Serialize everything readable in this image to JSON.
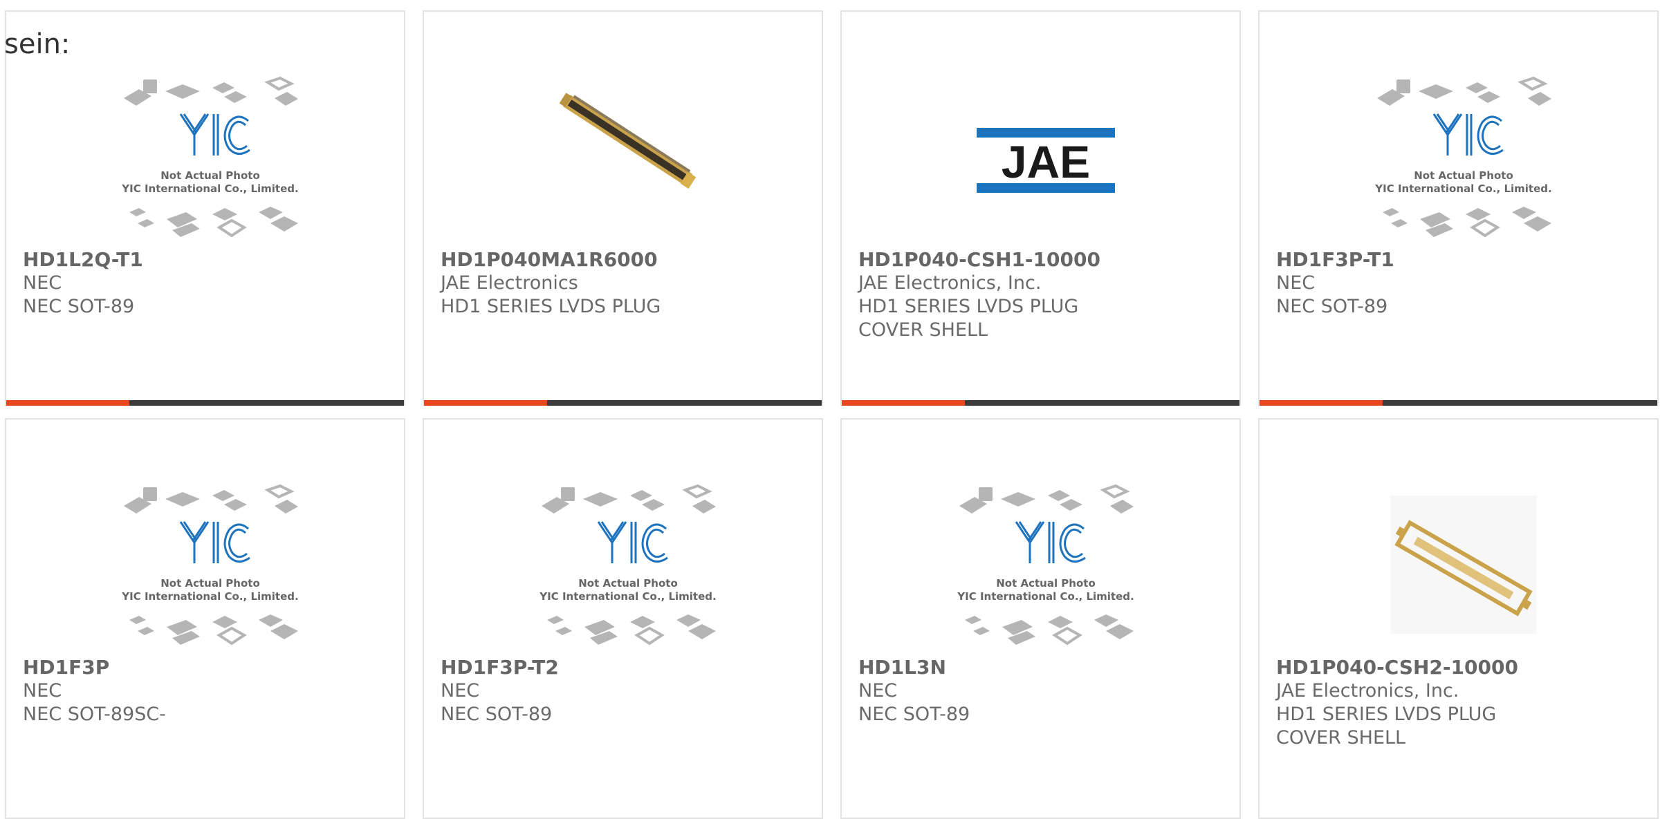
{
  "intro_text": "sein:",
  "theme": {
    "accent": "#e8461e",
    "bar": "#3a3a3a",
    "brand_blue": "#1e73be"
  },
  "placeholder_caption": [
    "Not Actual Photo",
    "YIC International Co., Limited."
  ],
  "placeholder_logo": "YIC",
  "jae_logo": "JAE",
  "progress_fraction": 0.31,
  "products": [
    {
      "part_number": "HD1L2Q-T1",
      "manufacturer": "NEC",
      "description": "NEC SOT-89",
      "image": "yic-placeholder"
    },
    {
      "part_number": "HD1P040MA1R6000",
      "manufacturer": "JAE Electronics",
      "description": "HD1 SERIES LVDS PLUG",
      "image": "connector-photo"
    },
    {
      "part_number": "HD1P040-CSH1-10000",
      "manufacturer": "JAE Electronics, Inc.",
      "description": "HD1 SERIES LVDS PLUG COVER SHELL",
      "image": "jae-logo"
    },
    {
      "part_number": "HD1F3P-T1",
      "manufacturer": "NEC",
      "description": "NEC SOT-89",
      "image": "yic-placeholder"
    },
    {
      "part_number": "HD1F3P",
      "manufacturer": "NEC",
      "description": "NEC SOT-89SC-",
      "image": "yic-placeholder"
    },
    {
      "part_number": "HD1F3P-T2",
      "manufacturer": "NEC",
      "description": "NEC SOT-89",
      "image": "yic-placeholder"
    },
    {
      "part_number": "HD1L3N",
      "manufacturer": "NEC",
      "description": "NEC SOT-89",
      "image": "yic-placeholder"
    },
    {
      "part_number": "HD1P040-CSH2-10000",
      "manufacturer": "JAE Electronics, Inc.",
      "description": "HD1 SERIES LVDS PLUG COVER SHELL",
      "image": "cover-shell-photo"
    }
  ]
}
